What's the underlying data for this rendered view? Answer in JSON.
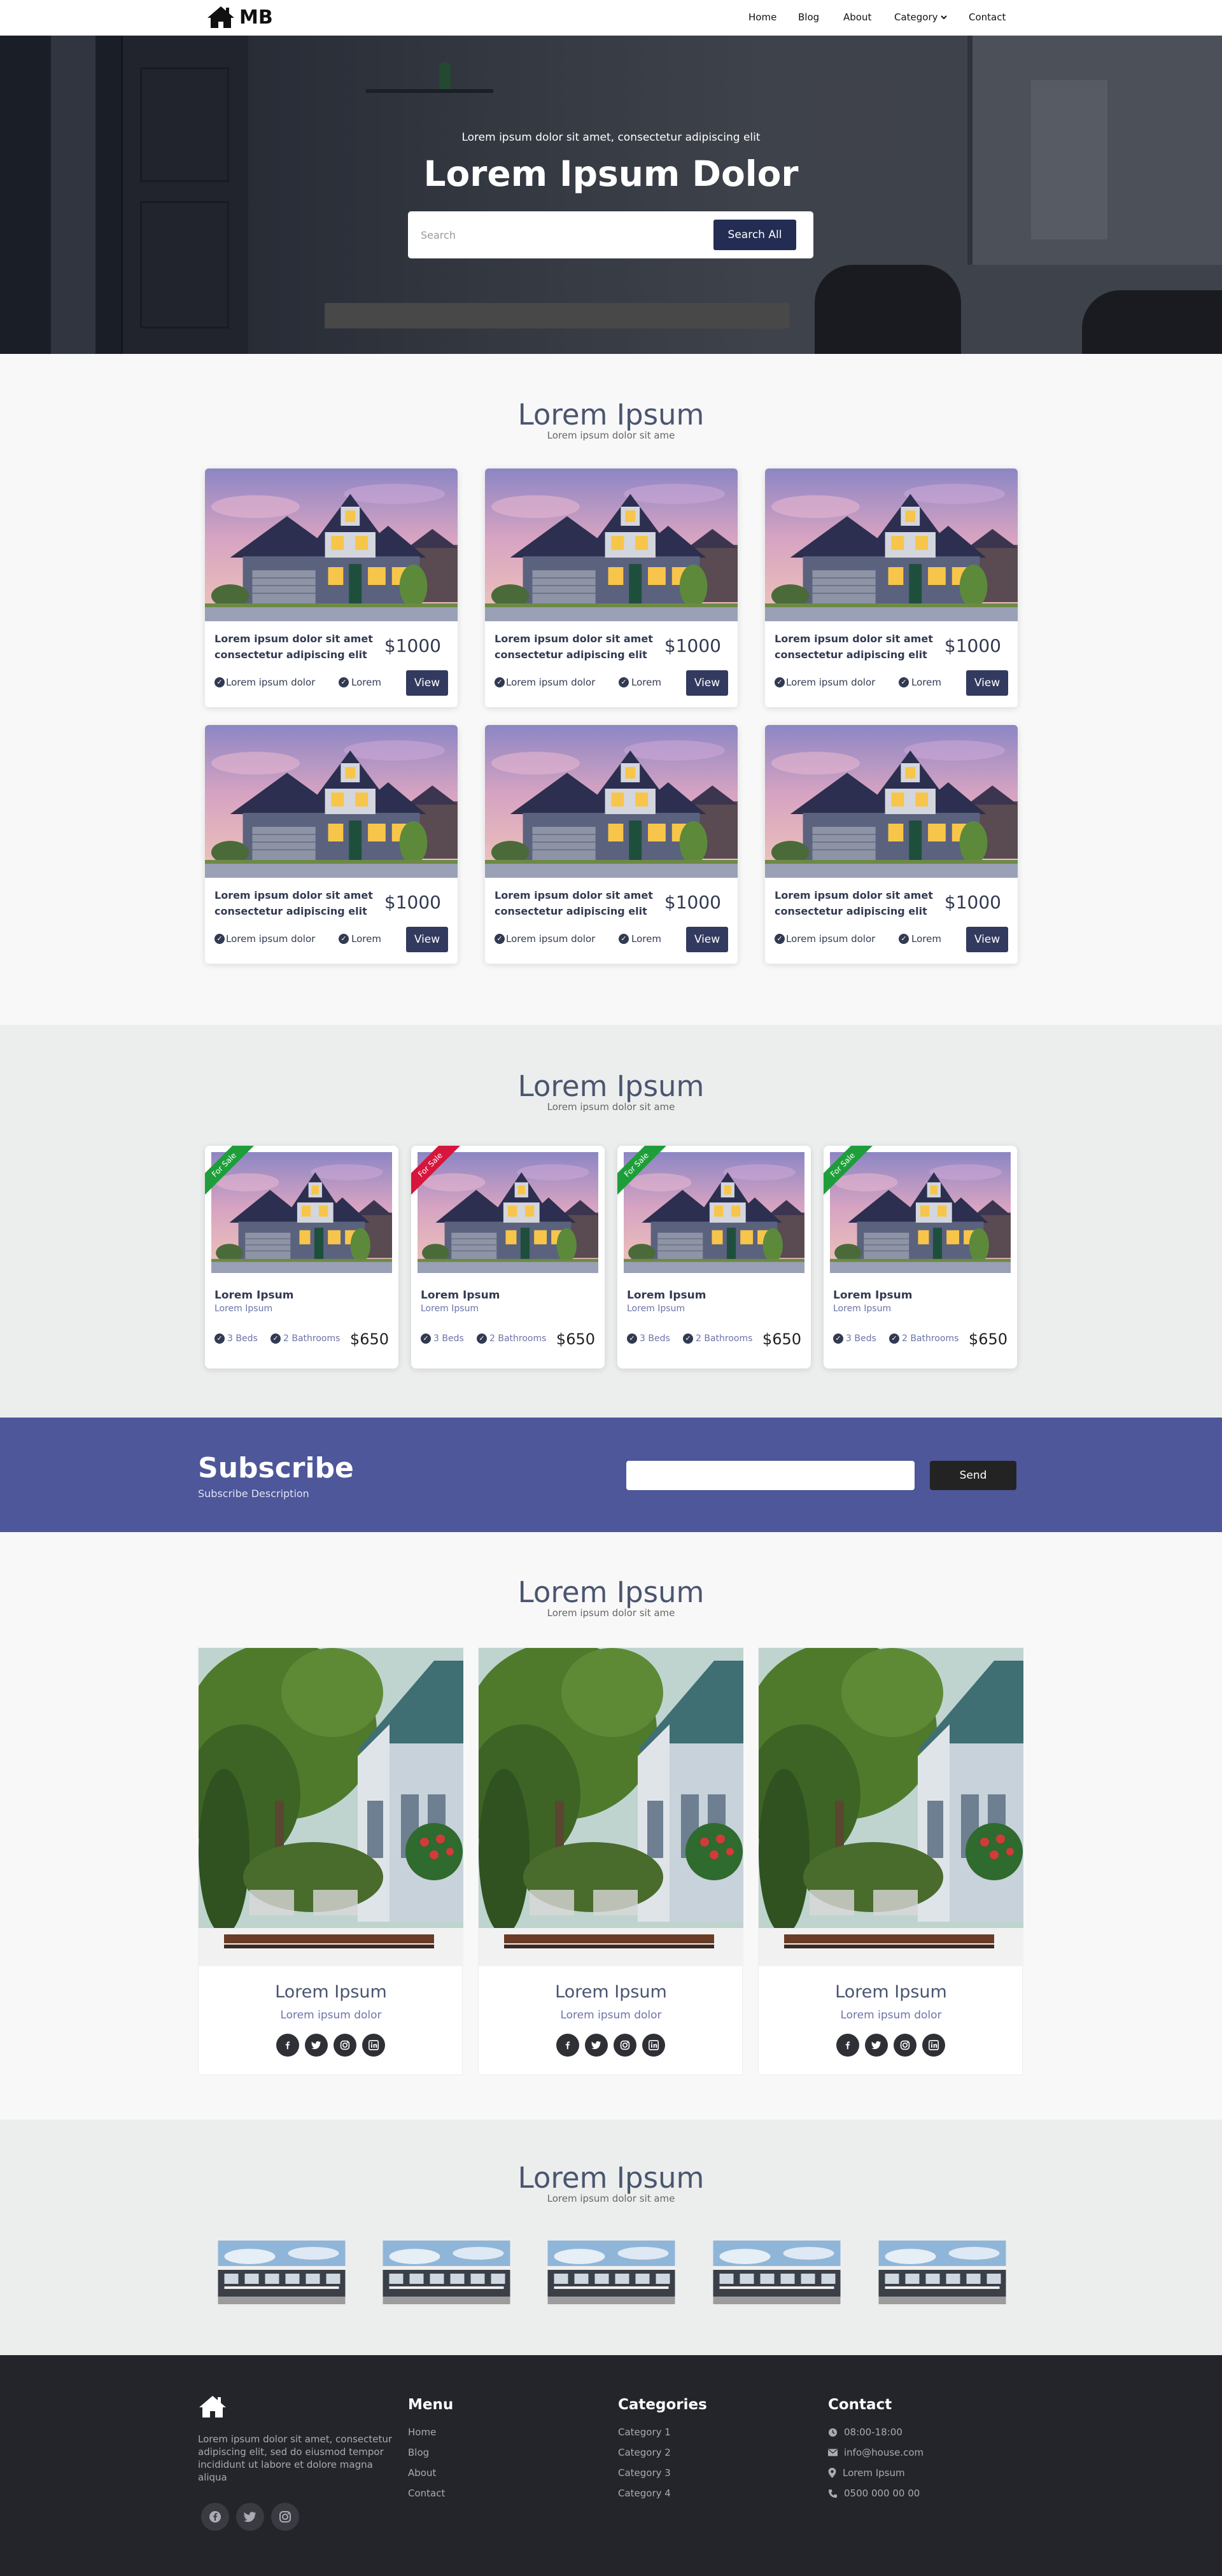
{
  "nav": {
    "logo_text": "MB",
    "links": [
      "Home",
      "Blog",
      "About",
      "Category",
      "Contact"
    ]
  },
  "hero": {
    "subtitle": "Lorem ipsum dolor sit amet, consectetur adipiscing elit",
    "title": "Lorem Ipsum Dolor",
    "search_placeholder": "Search",
    "search_button": "Search All"
  },
  "listings": {
    "title": "Lorem Ipsum",
    "subtitle": "Lorem ipsum dolor sit ame",
    "cards": [
      {
        "desc": "Lorem ipsum dolor sit amet consectetur adipiscing elit",
        "price": "$1000",
        "feature1": "Lorem ipsum dolor",
        "feature2": "Lorem",
        "button": "View"
      },
      {
        "desc": "Lorem ipsum dolor sit amet consectetur adipiscing elit",
        "price": "$1000",
        "feature1": "Lorem ipsum dolor",
        "feature2": "Lorem",
        "button": "View"
      },
      {
        "desc": "Lorem ipsum dolor sit amet consectetur adipiscing elit",
        "price": "$1000",
        "feature1": "Lorem ipsum dolor",
        "feature2": "Lorem",
        "button": "View"
      },
      {
        "desc": "Lorem ipsum dolor sit amet consectetur adipiscing elit",
        "price": "$1000",
        "feature1": "Lorem ipsum dolor",
        "feature2": "Lorem",
        "button": "View"
      },
      {
        "desc": "Lorem ipsum dolor sit amet consectetur adipiscing elit",
        "price": "$1000",
        "feature1": "Lorem ipsum dolor",
        "feature2": "Lorem",
        "button": "View"
      },
      {
        "desc": "Lorem ipsum dolor sit amet consectetur adipiscing elit",
        "price": "$1000",
        "feature1": "Lorem ipsum dolor",
        "feature2": "Lorem",
        "button": "View"
      }
    ]
  },
  "sale": {
    "title": "Lorem Ipsum",
    "subtitle": "Lorem ipsum dolor sit ame",
    "cards": [
      {
        "ribbon": "For Sale",
        "ribbon_color": "#1e9e3a",
        "title": "Lorem Ipsum",
        "subtitle": "Lorem Ipsum",
        "beds": "3 Beds",
        "baths": "2 Bathrooms",
        "price": "$650"
      },
      {
        "ribbon": "For Sale",
        "ribbon_color": "#d6163c",
        "title": "Lorem Ipsum",
        "subtitle": "Lorem Ipsum",
        "beds": "3 Beds",
        "baths": "2 Bathrooms",
        "price": "$650"
      },
      {
        "ribbon": "For Sale",
        "ribbon_color": "#1e9e3a",
        "title": "Lorem Ipsum",
        "subtitle": "Lorem Ipsum",
        "beds": "3 Beds",
        "baths": "2 Bathrooms",
        "price": "$650"
      },
      {
        "ribbon": "For Sale",
        "ribbon_color": "#1e9e3a",
        "title": "Lorem Ipsum",
        "subtitle": "Lorem Ipsum",
        "beds": "3 Beds",
        "baths": "2 Bathrooms",
        "price": "$650"
      }
    ]
  },
  "subscribe": {
    "title": "Subscribe",
    "description": "Subscribe Description",
    "button": "Send"
  },
  "team": {
    "title": "Lorem Ipsum",
    "subtitle": "Lorem ipsum dolor sit ame",
    "members": [
      {
        "name": "Lorem Ipsum",
        "role": "Lorem ipsum dolor"
      },
      {
        "name": "Lorem Ipsum",
        "role": "Lorem ipsum dolor"
      },
      {
        "name": "Lorem Ipsum",
        "role": "Lorem ipsum dolor"
      }
    ],
    "social_icons": [
      "facebook-icon",
      "twitter-icon",
      "instagram-icon",
      "linkedin-icon"
    ]
  },
  "gallery": {
    "title": "Lorem Ipsum",
    "subtitle": "Lorem ipsum dolor sit ame"
  },
  "footer": {
    "about": "Lorem ipsum dolor sit amet, consectetur adipiscing elit, sed do eiusmod tempor incididunt ut labore et dolore magna aliqua",
    "menu_title": "Menu",
    "menu": [
      "Home",
      "Blog",
      "About",
      "Contact"
    ],
    "categories_title": "Categories",
    "categories": [
      "Category 1",
      "Category 2",
      "Category 3",
      "Category 4"
    ],
    "contact_title": "Contact",
    "contact": {
      "hours": "08:00-18:00",
      "email": "info@house.com",
      "address": "Lorem Ipsum",
      "phone": "0500 000 00 00"
    }
  },
  "colors": {
    "primary": "#323a60",
    "subscribe_bg": "#4d5799",
    "footer_bg": "#24252b",
    "sale_green": "#1e9e3a",
    "sale_red": "#d6163c"
  }
}
